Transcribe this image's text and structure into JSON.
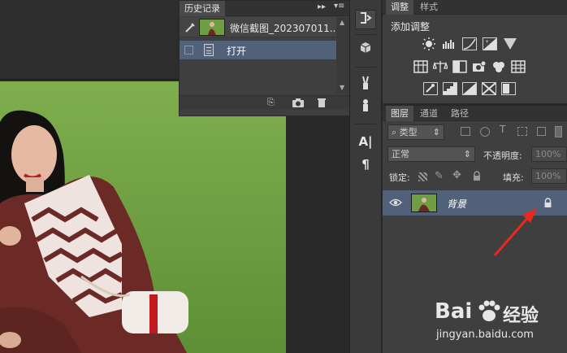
{
  "history_panel": {
    "tab_label": "历史记录",
    "snapshot_label": "微信截图_202307011...",
    "step_label": "打开"
  },
  "adjustments_panel": {
    "tabs": [
      "调整",
      "样式"
    ],
    "heading": "添加调整"
  },
  "layers_panel": {
    "tabs": [
      "图层",
      "通道",
      "路径"
    ],
    "filter_kind": "类型",
    "blend_mode": "正常",
    "opacity_label": "不透明度:",
    "opacity_value": "100%",
    "lock_label": "锁定:",
    "fill_label": "填充:",
    "fill_value": "100%",
    "layer_name": "背景"
  },
  "watermark": {
    "brand": "Bai",
    "brand_tail": "经验",
    "url": "jingyan.baidu.com"
  },
  "colors": {
    "panel_bg": "#3f3f3f",
    "selection": "#52617a",
    "annotation_red": "#e8291f",
    "grass": "#6a9a3e"
  }
}
